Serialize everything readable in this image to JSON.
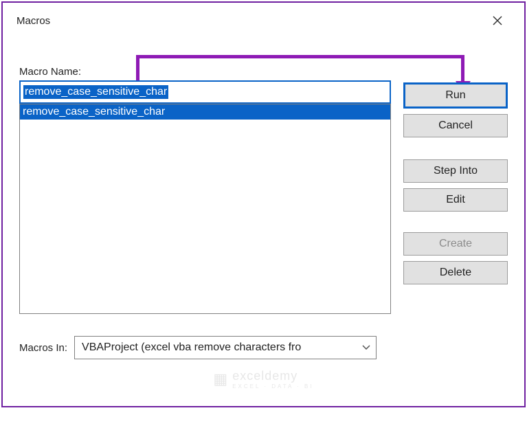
{
  "window": {
    "title": "Macros"
  },
  "labels": {
    "macro_name": "Macro Name:",
    "macros_in": "Macros In:"
  },
  "macro_name_input": "remove_case_sensitive_char",
  "macro_list": [
    "remove_case_sensitive_char"
  ],
  "buttons": {
    "run": "Run",
    "cancel": "Cancel",
    "step_into": "Step Into",
    "edit": "Edit",
    "create": "Create",
    "delete": "Delete"
  },
  "macros_in_value": "VBAProject (excel vba remove characters fro",
  "watermark": {
    "brand": "exceldemy",
    "tagline": "EXCEL · DATA · BI"
  }
}
